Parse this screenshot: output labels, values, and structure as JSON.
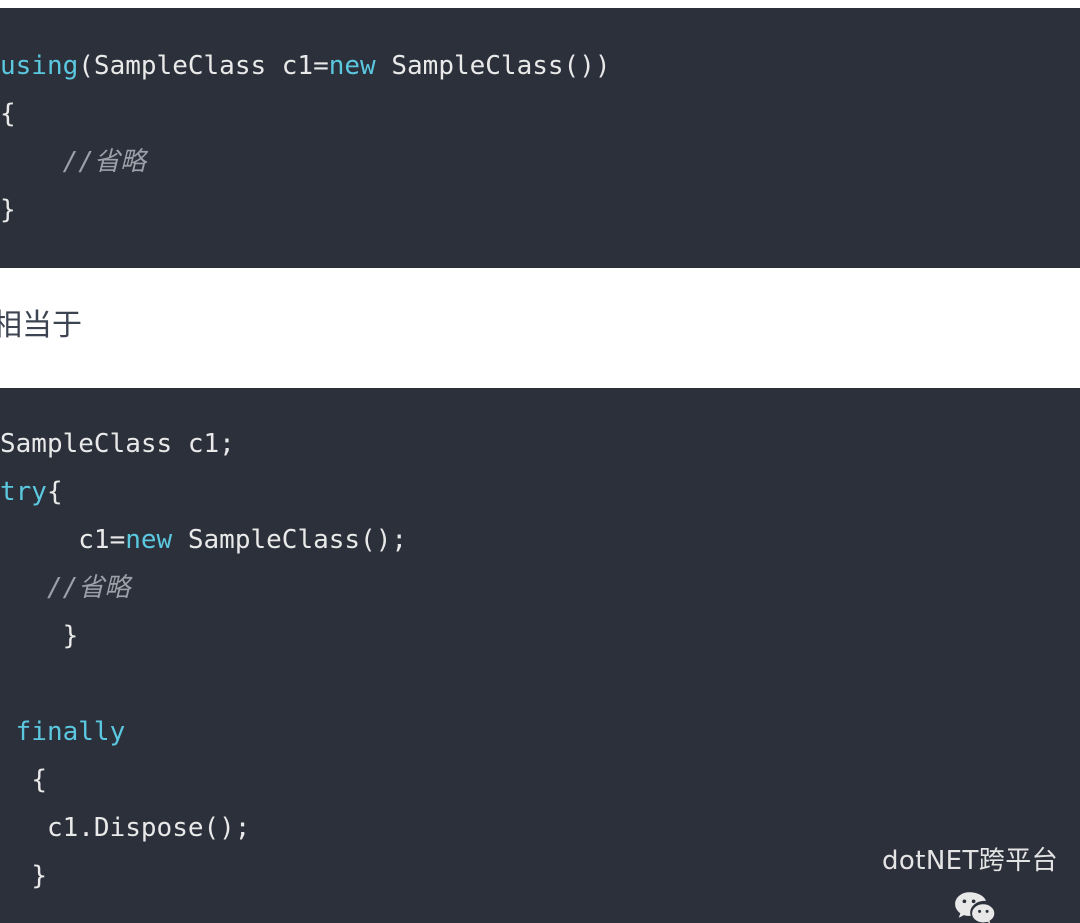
{
  "page": {
    "background": "#ffffff",
    "code_background": "#2b303b",
    "keyword_color": "#5bc8e0",
    "text_color": "#e9e9e9",
    "comment_color": "#9aa1a9",
    "body_text_color": "#3c4452"
  },
  "code_block_1": {
    "language": "csharp",
    "lines": [
      {
        "indent": "",
        "tokens": [
          {
            "text": "using",
            "type": "keyword"
          },
          {
            "text": "(SampleClass c1=",
            "type": "plain"
          },
          {
            "text": "new",
            "type": "keyword"
          },
          {
            "text": " SampleClass())",
            "type": "plain"
          }
        ]
      },
      {
        "indent": "",
        "tokens": [
          {
            "text": "{",
            "type": "plain"
          }
        ]
      },
      {
        "indent": "    ",
        "tokens": [
          {
            "text": "//省略",
            "type": "comment"
          }
        ]
      },
      {
        "indent": "",
        "tokens": [
          {
            "text": "}",
            "type": "plain"
          }
        ]
      }
    ]
  },
  "middle_text": {
    "content": "相当于"
  },
  "code_block_2": {
    "language": "csharp",
    "lines": [
      {
        "indent": "",
        "tokens": [
          {
            "text": "SampleClass c1;",
            "type": "plain"
          }
        ]
      },
      {
        "indent": "",
        "tokens": [
          {
            "text": "try",
            "type": "keyword"
          },
          {
            "text": "{",
            "type": "plain"
          }
        ]
      },
      {
        "indent": "     ",
        "tokens": [
          {
            "text": "c1=",
            "type": "plain"
          },
          {
            "text": "new",
            "type": "keyword"
          },
          {
            "text": " SampleClass();",
            "type": "plain"
          }
        ]
      },
      {
        "indent": "   ",
        "tokens": [
          {
            "text": "//省略",
            "type": "comment"
          }
        ]
      },
      {
        "indent": "    ",
        "tokens": [
          {
            "text": "}",
            "type": "plain"
          }
        ]
      },
      {
        "indent": "",
        "tokens": [
          {
            "text": "",
            "type": "blank"
          }
        ]
      },
      {
        "indent": " ",
        "tokens": [
          {
            "text": "finally",
            "type": "keyword"
          }
        ]
      },
      {
        "indent": "  ",
        "tokens": [
          {
            "text": "{",
            "type": "plain"
          }
        ]
      },
      {
        "indent": "   ",
        "tokens": [
          {
            "text": "c1.Dispose();",
            "type": "plain"
          }
        ]
      },
      {
        "indent": "  ",
        "tokens": [
          {
            "text": "}",
            "type": "plain"
          }
        ]
      }
    ]
  },
  "watermark": {
    "icon": "wechat-icon",
    "label": "dotNET跨平台"
  }
}
